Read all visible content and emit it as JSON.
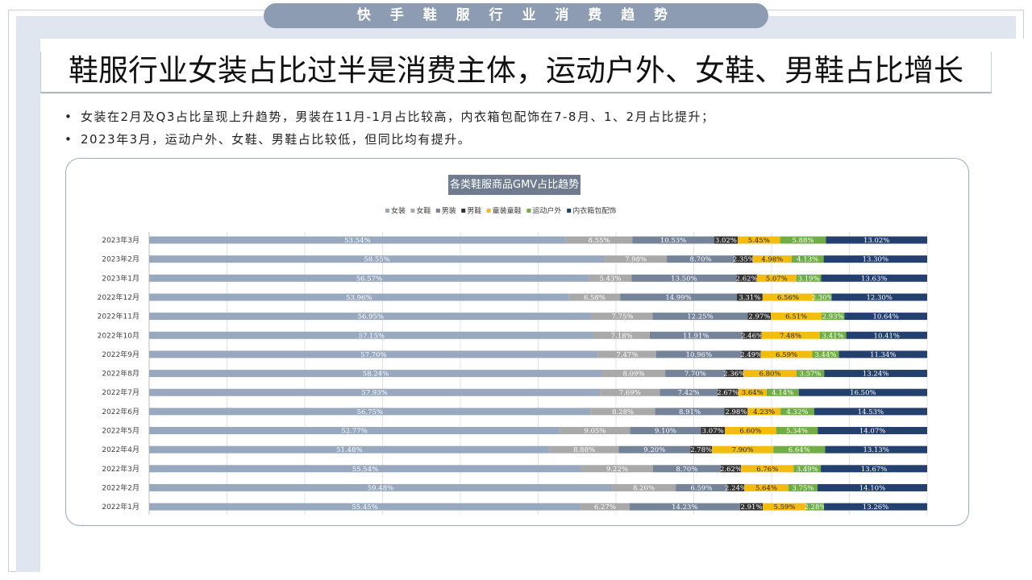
{
  "banner": "快 手 鞋 服 行 业 消 费 趋 势",
  "headline": "鞋服行业女装占比过半是消费主体，运动户外、女鞋、男鞋占比增长",
  "bullets": [
    "女装在2月及Q3占比呈现上升趋势，男装在11月-1月占比较高，内衣箱包配饰在7-8月、1、2月占比提升；",
    "2023年3月，运动户外、女鞋、男鞋占比较低，但同比均有提升。"
  ],
  "bullet_marker": "•",
  "colors": {
    "女装": "#98a9bf",
    "女鞋": "#a9a9a9",
    "男装": "#76849a",
    "男鞋": "#333333",
    "童装童鞋": "#f2bd0f",
    "运动户外": "#70ad47",
    "内衣箱包配饰": "#23406e"
  },
  "chart_data": {
    "type": "bar",
    "orientation": "horizontal",
    "stacked": "100%",
    "title": "各类鞋服商品GMV占比趋势",
    "legend_position": "top",
    "grid": true,
    "categories": [
      "2023年3月",
      "2023年2月",
      "2023年1月",
      "2022年12月",
      "2022年11月",
      "2022年10月",
      "2022年9月",
      "2022年8月",
      "2022年7月",
      "2022年6月",
      "2022年5月",
      "2022年4月",
      "2022年3月",
      "2022年2月",
      "2022年1月"
    ],
    "series": [
      {
        "name": "女装",
        "values": [
          53.54,
          58.55,
          56.57,
          53.96,
          56.95,
          57.15,
          57.7,
          58.24,
          57.93,
          56.75,
          52.77,
          51.48,
          55.54,
          59.48,
          55.45
        ]
      },
      {
        "name": "女鞋",
        "values": [
          8.55,
          7.98,
          5.43,
          6.58,
          7.75,
          7.18,
          7.47,
          8.09,
          7.69,
          8.28,
          9.05,
          8.88,
          9.22,
          8.2,
          6.27
        ]
      },
      {
        "name": "男装",
        "values": [
          10.53,
          8.7,
          13.5,
          14.99,
          12.25,
          11.91,
          10.96,
          7.7,
          7.42,
          8.91,
          9.1,
          9.2,
          8.7,
          6.59,
          14.23
        ]
      },
      {
        "name": "男鞋",
        "values": [
          3.02,
          2.35,
          2.62,
          3.31,
          2.97,
          2.46,
          2.49,
          2.36,
          2.67,
          2.98,
          3.07,
          2.78,
          2.62,
          2.24,
          2.91
        ]
      },
      {
        "name": "童装童鞋",
        "values": [
          5.45,
          4.98,
          5.07,
          6.56,
          6.51,
          7.48,
          6.59,
          6.8,
          3.64,
          4.23,
          6.6,
          7.9,
          6.76,
          5.64,
          5.59
        ]
      },
      {
        "name": "运动户外",
        "values": [
          5.88,
          4.13,
          3.19,
          2.3,
          2.93,
          3.41,
          3.44,
          3.57,
          4.14,
          4.32,
          5.34,
          6.64,
          3.49,
          3.75,
          2.28
        ]
      },
      {
        "name": "内衣箱包配饰",
        "values": [
          13.02,
          13.3,
          13.63,
          12.3,
          10.64,
          10.41,
          11.34,
          13.24,
          16.5,
          14.53,
          14.07,
          13.13,
          13.67,
          14.1,
          13.26
        ]
      }
    ],
    "value_suffix": "%"
  }
}
